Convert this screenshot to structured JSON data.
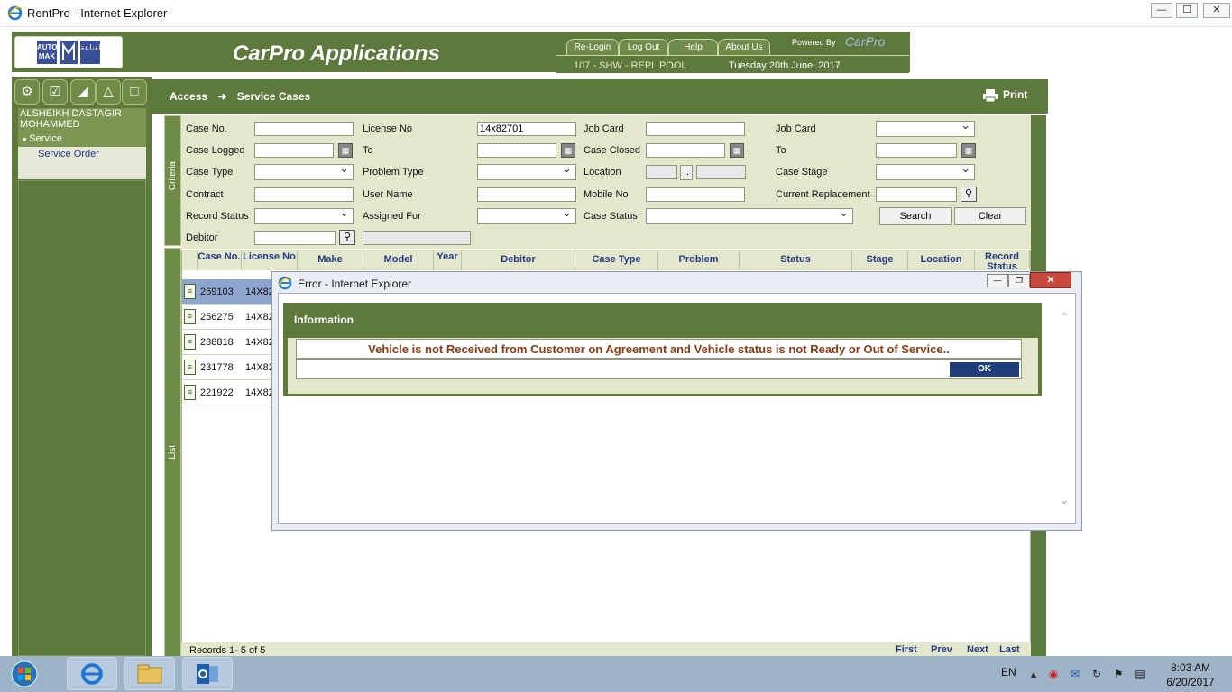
{
  "window": {
    "title": "RentPro - Internet Explorer",
    "min": "—",
    "max": "☐",
    "close": "✕"
  },
  "header": {
    "app_title": "CarPro Applications",
    "logo_left": "AUTO MAK",
    "logo_right": "القناعة",
    "tabs": [
      "Re-Login",
      "Log Out",
      "Help",
      "About Us"
    ],
    "powered_by": "Powered By",
    "brand": "CarPro",
    "branch": "107 - SHW - REPL POOL",
    "date": "Tuesday 20th June, 2017"
  },
  "sidebar": {
    "icons": [
      "gears-icon",
      "checklist-icon",
      "stairs-icon",
      "car-icon",
      "car-front-icon"
    ],
    "user": "ALSHEIKH DASTAGIR MOHAMMED",
    "menu": [
      {
        "label": "Service",
        "bullet": "■"
      },
      {
        "label": "Service Order"
      }
    ]
  },
  "content": {
    "crumb_access": "Access",
    "crumb_arrow": "➜",
    "crumb_page": "Service Cases",
    "print": "Print",
    "criteria_label": "Criteria",
    "list_label": "List"
  },
  "criteria": {
    "labels": {
      "case_no": "Case No.",
      "license_no": "License No",
      "job_card1": "Job Card",
      "job_card2": "Job Card",
      "case_logged": "Case Logged",
      "to1": "To",
      "case_closed": "Case Closed",
      "to2": "To",
      "case_type": "Case Type",
      "problem_type": "Problem Type",
      "location": "Location",
      "case_stage": "Case Stage",
      "contract": "Contract",
      "user_name": "User Name",
      "mobile_no": "Mobile No",
      "current_replacement": "Current Replacement",
      "record_status": "Record Status",
      "assigned_for": "Assigned For",
      "case_status": "Case Status",
      "debitor": "Debitor"
    },
    "values": {
      "license_no": "14x82701",
      "location_btn": ".."
    },
    "buttons": {
      "search": "Search",
      "clear": "Clear"
    }
  },
  "grid": {
    "columns": [
      "Case No.",
      "License No",
      "Make",
      "Model",
      "Year",
      "Debitor",
      "Case Type",
      "Problem",
      "Status",
      "Stage",
      "Location",
      "Record Status"
    ],
    "rows": [
      {
        "case_no": "269103",
        "license": "14X82"
      },
      {
        "case_no": "256275",
        "license": "14X82"
      },
      {
        "case_no": "238818",
        "license": "14X82"
      },
      {
        "case_no": "231778",
        "license": "14X82"
      },
      {
        "case_no": "221922",
        "license": "14X82"
      }
    ],
    "records": "Records  1- 5 of  5",
    "pager": [
      "First",
      "Prev",
      "Next",
      "Last"
    ]
  },
  "dialog": {
    "title": "Error - Internet Explorer",
    "header": "Information",
    "message": "Vehicle is not Received from Customer on Agreement and Vehicle status is not Ready or Out of Service..",
    "ok": "OK",
    "close": "✕",
    "min": "—",
    "max": "❐"
  },
  "taskbar": {
    "lang": "EN",
    "time": "8:03 AM",
    "date": "6/20/2017"
  },
  "colors": {
    "accent": "#5d7a3c",
    "panel": "#e4e7cb",
    "link": "#203a86",
    "error": "#8b3a12",
    "ok": "#1d3e78"
  }
}
